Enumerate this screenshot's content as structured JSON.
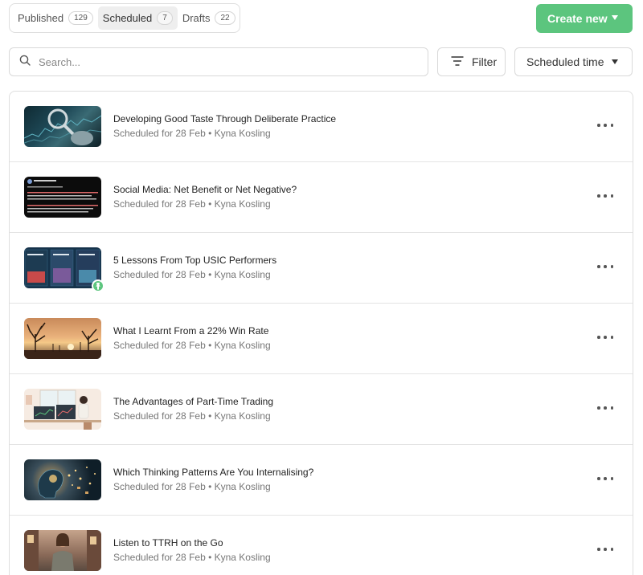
{
  "tabs": [
    {
      "label": "Published",
      "count": "129"
    },
    {
      "label": "Scheduled",
      "count": "7"
    },
    {
      "label": "Drafts",
      "count": "22"
    }
  ],
  "create_button": {
    "label": "Create new"
  },
  "search": {
    "placeholder": "Search..."
  },
  "filter": {
    "label": "Filter"
  },
  "sort": {
    "label": "Scheduled time"
  },
  "posts": [
    {
      "title": "Developing Good Taste Through Deliberate Practice",
      "meta": "Scheduled for 28 Feb • Kyna Kosling"
    },
    {
      "title": "Social Media: Net Benefit or Net Negative?",
      "meta": "Scheduled for 28 Feb • Kyna Kosling"
    },
    {
      "title": "5 Lessons From Top USIC Performers",
      "meta": "Scheduled for 28 Feb • Kyna Kosling"
    },
    {
      "title": "What I Learnt From a 22% Win Rate",
      "meta": "Scheduled for 28 Feb • Kyna Kosling"
    },
    {
      "title": "The Advantages of Part-Time Trading",
      "meta": "Scheduled for 28 Feb • Kyna Kosling"
    },
    {
      "title": "Which Thinking Patterns Are You Internalising?",
      "meta": "Scheduled for 28 Feb • Kyna Kosling"
    },
    {
      "title": "Listen to TTRH on the Go",
      "meta": "Scheduled for 28 Feb • Kyna Kosling"
    }
  ],
  "colors": {
    "accent": "#5cc57e",
    "border": "#dedede",
    "muted_text": "#777777"
  }
}
